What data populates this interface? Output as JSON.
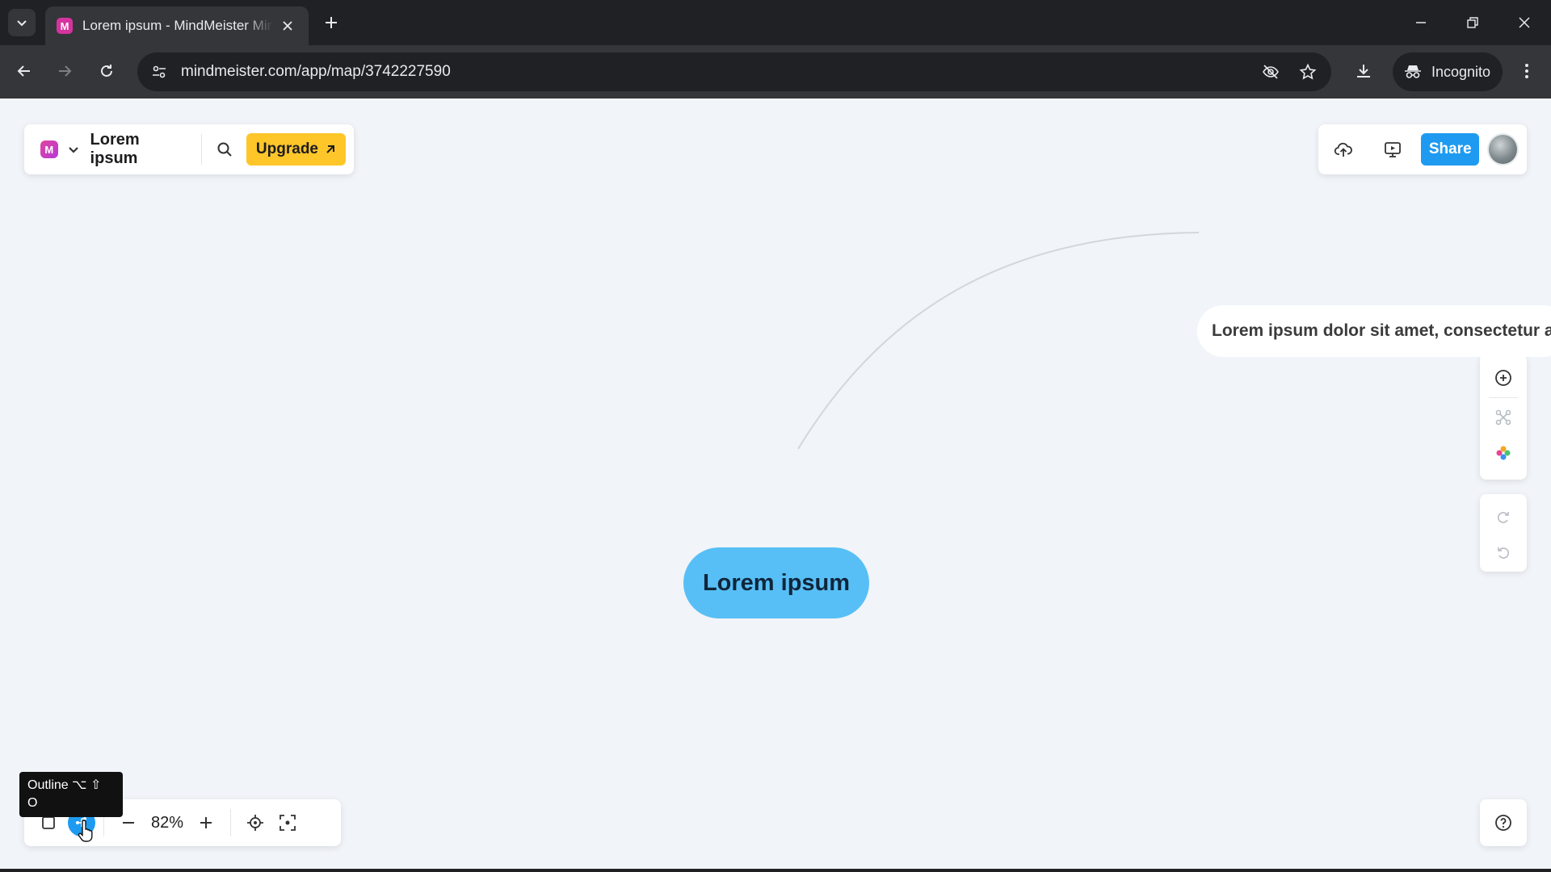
{
  "browser": {
    "tab_title": "Lorem ipsum - MindMeister Mind Map",
    "favicon_letter": "M",
    "url": "mindmeister.com/app/map/3742227590",
    "incognito_label": "Incognito"
  },
  "app": {
    "logo_letter": "M",
    "map_title": "Lorem ipsum",
    "upgrade_label": "Upgrade",
    "share_label": "Share",
    "zoom_level": "82%",
    "tooltip_title": "Outline ⌥ ⇧",
    "tooltip_key": "O"
  },
  "mindmap": {
    "root_topic": "Lorem ipsum",
    "child_topic": "Lorem ipsum dolor sit amet, consectetur a"
  },
  "colors": {
    "root_fill": "#57bff6",
    "accent_blue": "#1e9bf0",
    "upgrade_yellow": "#ffc629"
  }
}
